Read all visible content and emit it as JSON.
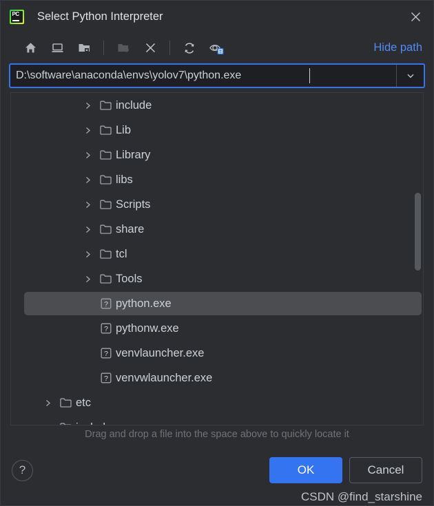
{
  "window": {
    "title": "Select Python Interpreter",
    "app_icon": "pycharm-logo",
    "close_icon": "close-icon"
  },
  "toolbar": {
    "buttons": [
      {
        "name": "home-button",
        "icon": "home-icon",
        "disabled": false
      },
      {
        "name": "desktop-button",
        "icon": "desktop-icon",
        "disabled": false
      },
      {
        "name": "project-folder-button",
        "icon": "folder-with-dot-icon",
        "disabled": false
      },
      {
        "name": "new-folder-button",
        "icon": "folder-plus-icon",
        "disabled": true
      },
      {
        "name": "delete-button",
        "icon": "close-x-icon",
        "disabled": false
      },
      {
        "name": "refresh-button",
        "icon": "refresh-icon",
        "disabled": false
      },
      {
        "name": "show-hidden-files-button",
        "icon": "eye-with-badge-icon",
        "disabled": false
      }
    ],
    "hide_path_label": "Hide path"
  },
  "path_field": {
    "value": "D:\\software\\anaconda\\envs\\yolov7\\python.exe",
    "placeholder": "",
    "dropdown_icon": "chevron-down-icon"
  },
  "tree": {
    "rows": [
      {
        "label": "include",
        "type": "folder",
        "indent": 1,
        "expandable": true,
        "selected": false
      },
      {
        "label": "Lib",
        "type": "folder",
        "indent": 1,
        "expandable": true,
        "selected": false
      },
      {
        "label": "Library",
        "type": "folder",
        "indent": 1,
        "expandable": true,
        "selected": false
      },
      {
        "label": "libs",
        "type": "folder",
        "indent": 1,
        "expandable": true,
        "selected": false
      },
      {
        "label": "Scripts",
        "type": "folder",
        "indent": 1,
        "expandable": true,
        "selected": false
      },
      {
        "label": "share",
        "type": "folder",
        "indent": 1,
        "expandable": true,
        "selected": false
      },
      {
        "label": "tcl",
        "type": "folder",
        "indent": 1,
        "expandable": true,
        "selected": false
      },
      {
        "label": "Tools",
        "type": "folder",
        "indent": 1,
        "expandable": true,
        "selected": false
      },
      {
        "label": "python.exe",
        "type": "file",
        "indent": 1,
        "expandable": false,
        "selected": true
      },
      {
        "label": "pythonw.exe",
        "type": "file",
        "indent": 1,
        "expandable": false,
        "selected": false
      },
      {
        "label": "venvlauncher.exe",
        "type": "file",
        "indent": 1,
        "expandable": false,
        "selected": false
      },
      {
        "label": "venvwlauncher.exe",
        "type": "file",
        "indent": 1,
        "expandable": false,
        "selected": false
      },
      {
        "label": "etc",
        "type": "folder",
        "indent": 0,
        "expandable": true,
        "selected": false
      },
      {
        "label": "include",
        "type": "folder",
        "indent": 0,
        "expandable": true,
        "selected": false
      }
    ],
    "scrollbar": {
      "name": "tree-scrollbar"
    }
  },
  "hint": "Drag and drop a file into the space above to quickly locate it",
  "footer": {
    "help_label": "?",
    "ok_label": "OK",
    "cancel_label": "Cancel"
  },
  "watermark": "CSDN @find_starshine",
  "colors": {
    "dialog_bg": "#2b2d30",
    "field_bg": "#1e1f22",
    "accent_blue": "#3574f0",
    "link_blue": "#548af7",
    "text": "#cdd1d8",
    "selection": "#4b4d51",
    "hint_text": "#6f7277"
  }
}
